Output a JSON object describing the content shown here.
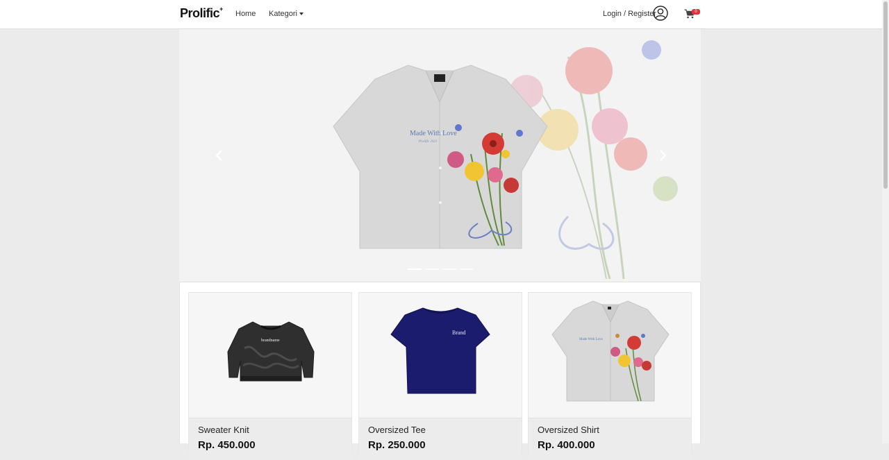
{
  "navbar": {
    "brand": "Prolific",
    "brand_mark": "+",
    "links": {
      "home": "Home",
      "kategori": "Kategori"
    },
    "login_label": "Login / Register",
    "cart_count": "0",
    "icons": {
      "avatar": "user-circle-icon",
      "cart": "shopping-cart-icon"
    }
  },
  "carousel": {
    "slide": {
      "shirt_text": "Made With Love",
      "shirt_subtext": "Prolific 2021"
    },
    "indicator_count": 4,
    "active_indicator": 0,
    "icons": {
      "prev": "chevron-left-icon",
      "next": "chevron-right-icon"
    }
  },
  "products": [
    {
      "name": "Sweater Knit",
      "price": "Rp. 450.000",
      "print": "brandname"
    },
    {
      "name": "Oversized Tee",
      "price": "Rp. 250.000",
      "print": "Brand"
    },
    {
      "name": "Oversized Shirt",
      "price": "Rp. 400.000",
      "print": "Made With Love"
    }
  ],
  "colors": {
    "accent": "#d9363e",
    "page_bg": "#ebebeb",
    "tee": "#1c1c6e",
    "sweater": "#2f2f2f"
  }
}
